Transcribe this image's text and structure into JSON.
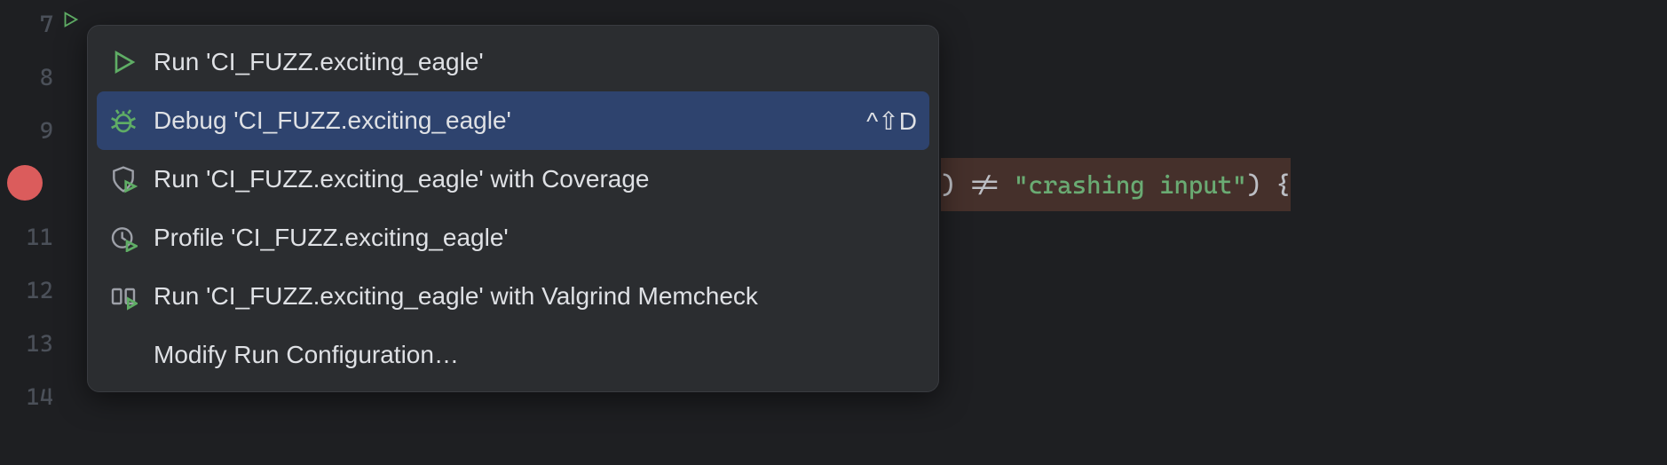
{
  "gutter": {
    "lines": [
      "7",
      "8",
      "9",
      "",
      "11",
      "12",
      "13",
      "14"
    ],
    "breakpoint_row_index": 3
  },
  "code": {
    "line10_right": " != \"crashing input\") {",
    "line10_paren": ")"
  },
  "menu": {
    "items": [
      {
        "label": "Run 'CI_FUZZ.exciting_eagle'",
        "icon": "play",
        "shortcut": ""
      },
      {
        "label": "Debug 'CI_FUZZ.exciting_eagle'",
        "icon": "bug",
        "shortcut": "^⇧D",
        "selected": true
      },
      {
        "label": "Run 'CI_FUZZ.exciting_eagle' with Coverage",
        "icon": "shield-play",
        "shortcut": ""
      },
      {
        "label": "Profile 'CI_FUZZ.exciting_eagle'",
        "icon": "clock-play",
        "shortcut": ""
      },
      {
        "label": "Run 'CI_FUZZ.exciting_eagle' with Valgrind Memcheck",
        "icon": "valgrind",
        "shortcut": ""
      },
      {
        "label": "Modify Run Configuration…",
        "icon": "",
        "shortcut": ""
      }
    ]
  }
}
